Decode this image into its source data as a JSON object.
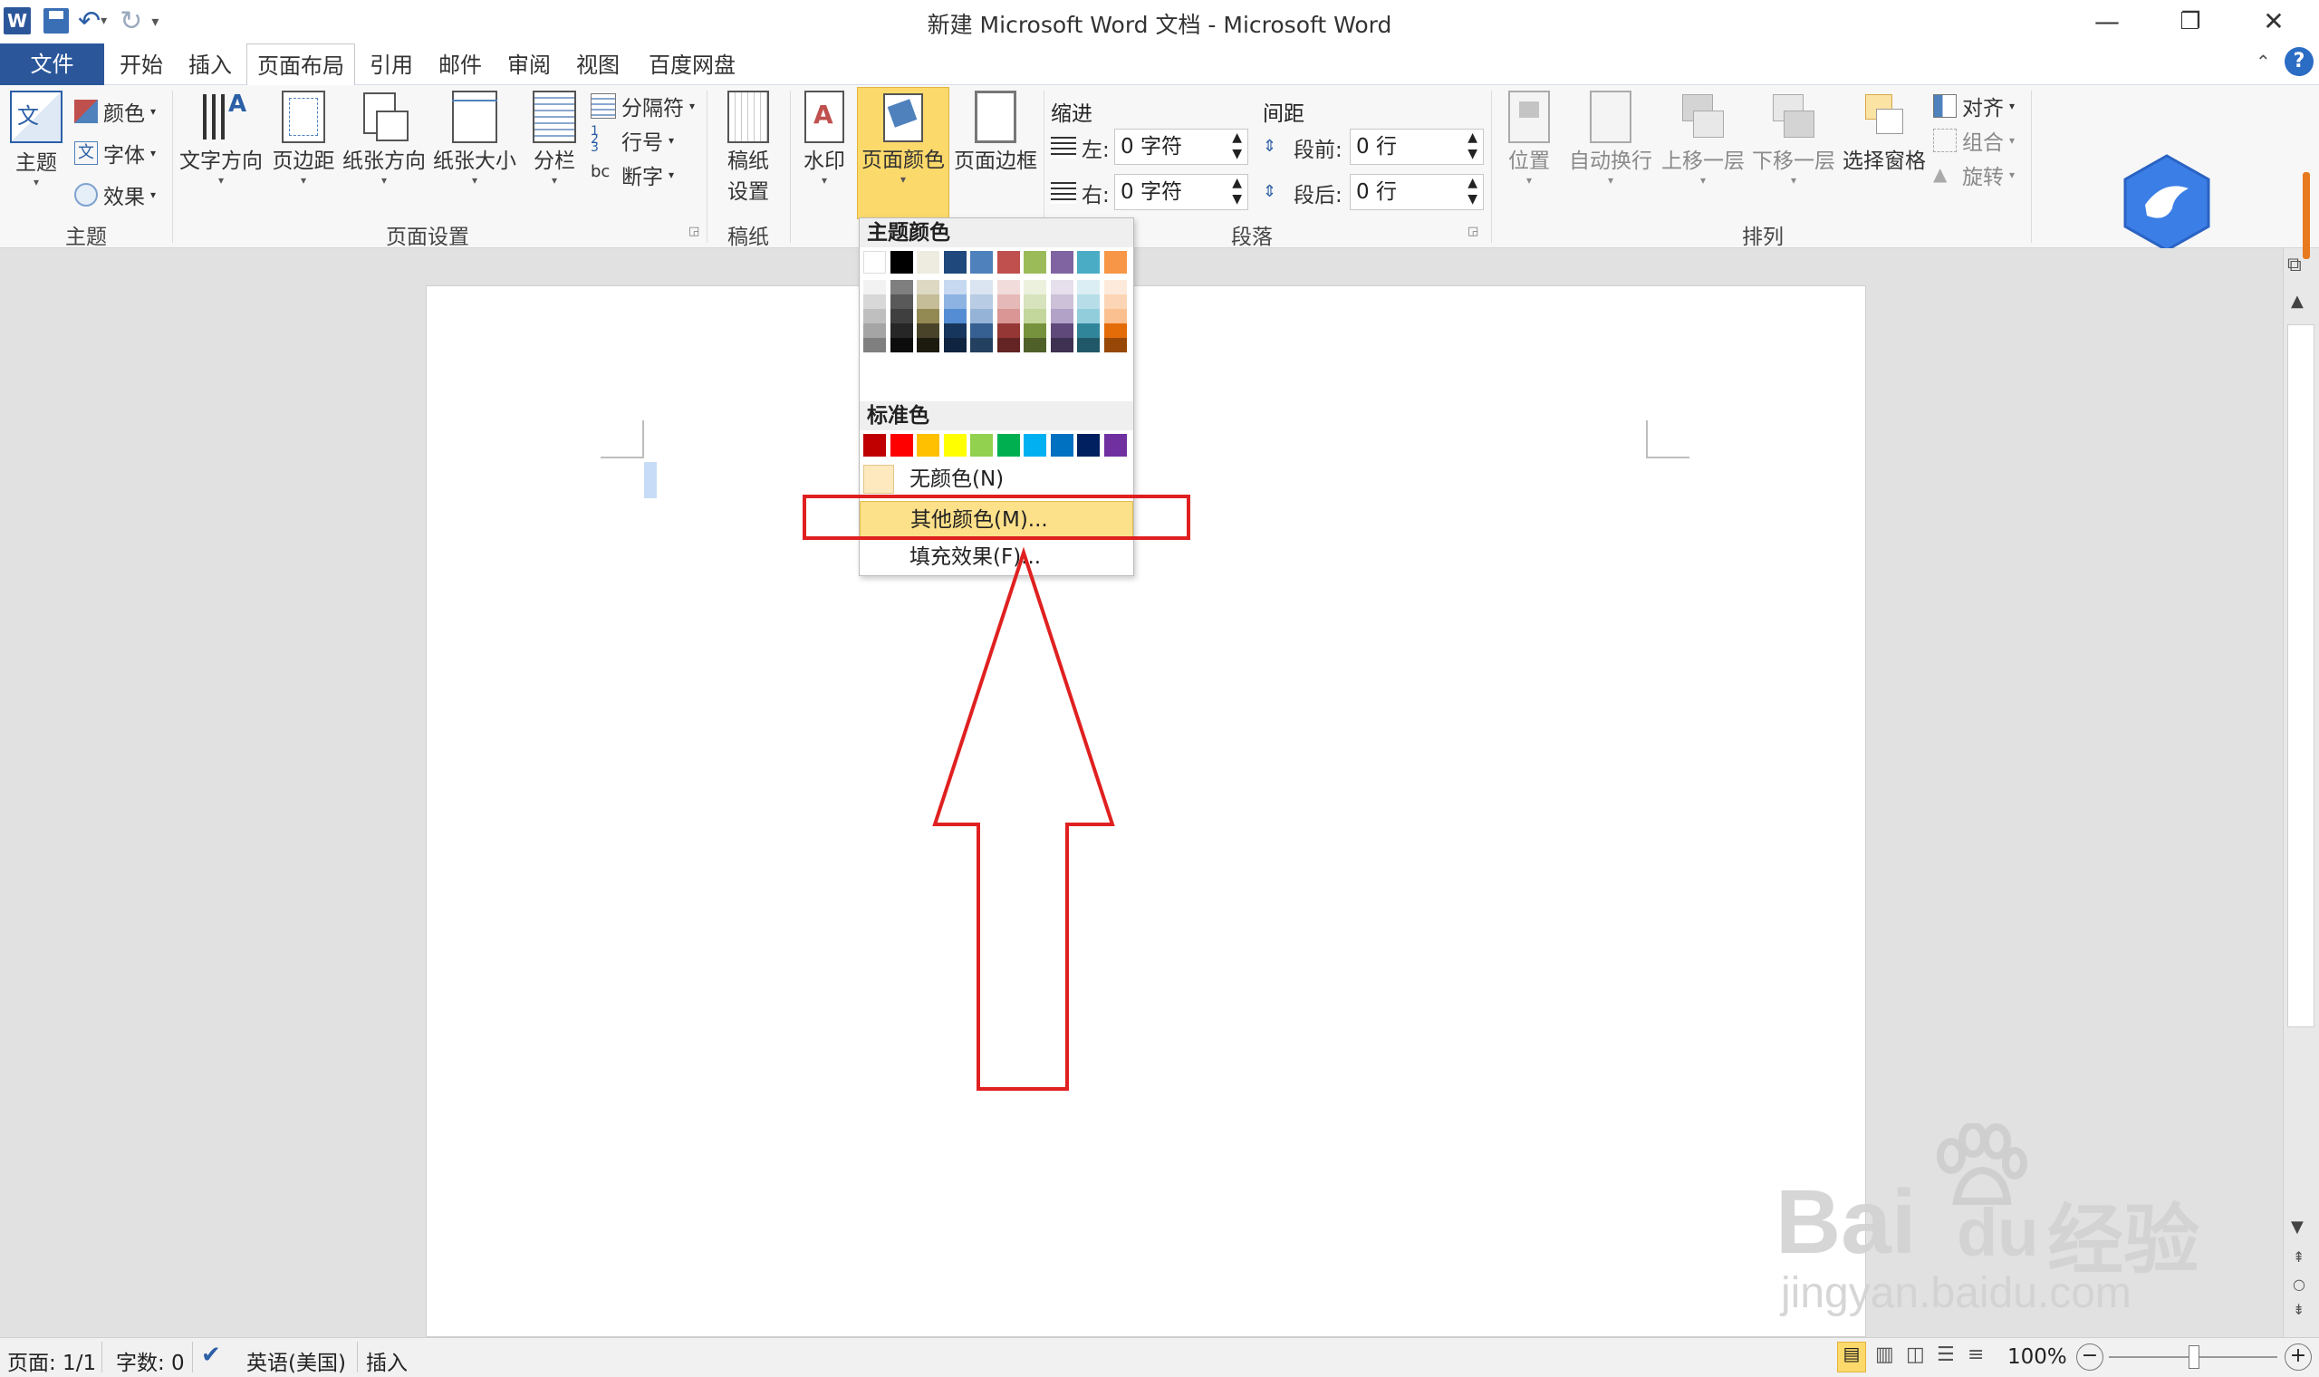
{
  "window": {
    "title": "新建 Microsoft Word 文档 - Microsoft Word",
    "quick_access": [
      "save-icon",
      "undo-icon",
      "redo-icon",
      "customize-icon"
    ]
  },
  "tabs": {
    "file": "文件",
    "items": [
      "开始",
      "插入",
      "页面布局",
      "引用",
      "邮件",
      "审阅",
      "视图",
      "百度网盘"
    ],
    "active_index": 2
  },
  "ribbon": {
    "theme": {
      "themes_label": "主题",
      "colors": "颜色",
      "fonts": "字体",
      "effects": "效果",
      "group": "主题"
    },
    "page_setup": {
      "text_direction": "文字方向",
      "margins": "页边距",
      "orientation": "纸张方向",
      "size": "纸张大小",
      "columns": "分栏",
      "breaks": "分隔符",
      "line_numbers": "行号",
      "hyphenation": "断字",
      "group": "页面设置"
    },
    "manuscript": {
      "line1": "稿纸",
      "line2": "设置",
      "group": "稿纸"
    },
    "page_background": {
      "watermark": "水印",
      "page_color": "页面颜色",
      "page_borders": "页面边框"
    },
    "paragraph": {
      "indent_title": "缩进",
      "indent_left_label": "左:",
      "indent_left_value": "0 字符",
      "indent_right_label": "右:",
      "indent_right_value": "0 字符",
      "spacing_title": "间距",
      "spacing_before_label": "段前:",
      "spacing_before_value": "0 行",
      "spacing_after_label": "段后:",
      "spacing_after_value": "0 行",
      "group": "段落"
    },
    "arrange": {
      "position": "位置",
      "wrap_text": "自动换行",
      "bring_forward": "上移一层",
      "send_backward": "下移一层",
      "selection_pane": "选择窗格",
      "align": "对齐",
      "group_cmd": "组合",
      "rotate": "旋转",
      "group": "排列"
    }
  },
  "dropdown": {
    "theme_colors_title": "主题颜色",
    "standard_colors_title": "标准色",
    "theme_top_row": [
      "#ffffff",
      "#000000",
      "#eeece1",
      "#1f497d",
      "#4f81bd",
      "#c0504d",
      "#9bbb59",
      "#8064a2",
      "#4bacc6",
      "#f79646"
    ],
    "theme_shades": [
      [
        "#f2f2f2",
        "#d8d8d8",
        "#bfbfbf",
        "#a5a5a5",
        "#7f7f7f"
      ],
      [
        "#7f7f7f",
        "#595959",
        "#3f3f3f",
        "#262626",
        "#0c0c0c"
      ],
      [
        "#ddd9c3",
        "#c4bd97",
        "#938953",
        "#494429",
        "#1d1b10"
      ],
      [
        "#c6d9f0",
        "#8db3e2",
        "#548dd4",
        "#17365d",
        "#0f243e"
      ],
      [
        "#dbe5f1",
        "#b8cce4",
        "#95b3d7",
        "#366092",
        "#244061"
      ],
      [
        "#f2dcdb",
        "#e5b9b7",
        "#d99694",
        "#953734",
        "#632423"
      ],
      [
        "#ebf1dd",
        "#d7e3bc",
        "#c3d69b",
        "#76923c",
        "#4f6128"
      ],
      [
        "#e5e0ec",
        "#ccc1d9",
        "#b2a2c7",
        "#5f497a",
        "#3f3151"
      ],
      [
        "#dbeef3",
        "#b7dde8",
        "#92cddc",
        "#31859b",
        "#205867"
      ],
      [
        "#fdeada",
        "#fbd5b5",
        "#fac08f",
        "#e36c09",
        "#974806"
      ]
    ],
    "standard_colors": [
      "#c00000",
      "#ff0000",
      "#ffc000",
      "#ffff00",
      "#92d050",
      "#00b050",
      "#00b0f0",
      "#0070c0",
      "#002060",
      "#7030a0"
    ],
    "no_color": "无颜色(N)",
    "more_colors": "其他颜色(M)...",
    "fill_effects": "填充效果(F)..."
  },
  "statusbar": {
    "page": "页面: 1/1",
    "words": "字数: 0",
    "language": "英语(美国)",
    "mode": "插入",
    "zoom": "100%"
  },
  "watermark": {
    "brand": "Bai",
    "brand2": "du",
    "cn": "经验",
    "url": "jingyan.baidu.com"
  },
  "annotation": {
    "highlight_color": "#e02020"
  }
}
